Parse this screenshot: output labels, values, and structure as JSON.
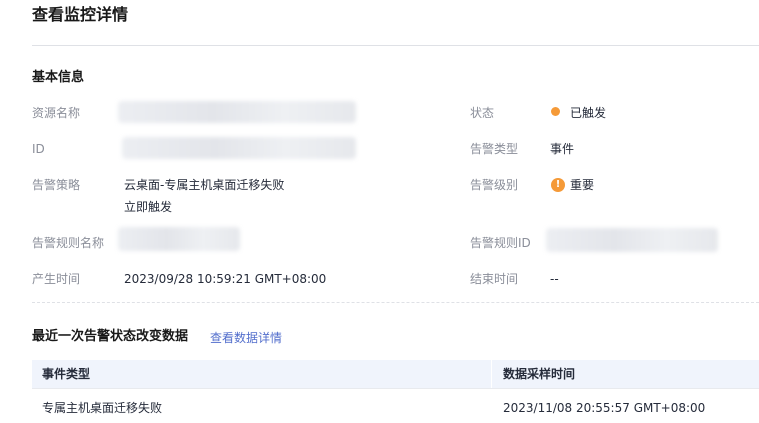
{
  "page": {
    "title": "查看监控详情"
  },
  "basic_info": {
    "section_title": "基本信息",
    "left": {
      "resource_name_label": "资源名称",
      "id_label": "ID",
      "policy_label": "告警策略",
      "policy_value_line1": "云桌面-专属主机桌面迁移失败",
      "policy_value_line2": "立即触发",
      "rule_name_label": "告警规则名称",
      "created_time_label": "产生时间",
      "created_time_value": "2023/09/28 10:59:21 GMT+08:00"
    },
    "right": {
      "status_label": "状态",
      "status_value": "已触发",
      "alarm_type_label": "告警类型",
      "alarm_type_value": "事件",
      "alarm_level_label": "告警级别",
      "alarm_level_value": "重要",
      "rule_id_label": "告警规则ID",
      "end_time_label": "结束时间",
      "end_time_value": "--"
    },
    "colors": {
      "status_dot": "#f59a38",
      "severity_icon": "#f59a38"
    }
  },
  "recent_change": {
    "title": "最近一次告警状态改变数据",
    "link_label": "查看数据详情",
    "table": {
      "columns": [
        "事件类型",
        "数据采样时间"
      ],
      "rows": [
        [
          "专属主机桌面迁移失败",
          "2023/11/08 20:55:57 GMT+08:00"
        ]
      ]
    }
  },
  "icons": {
    "status_dot": "status-dot-icon",
    "severity": "severity-important-icon",
    "severity_glyph": "!"
  }
}
